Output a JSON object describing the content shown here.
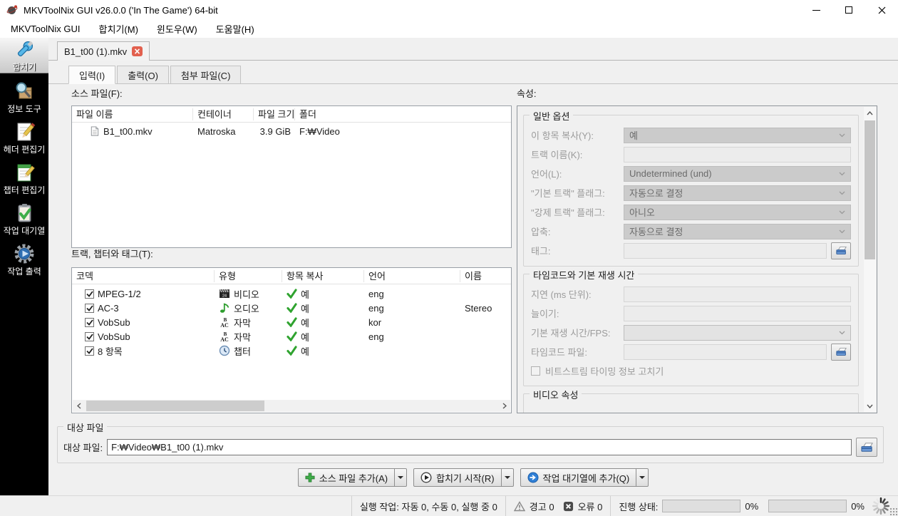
{
  "titlebar": {
    "title": "MKVToolNix GUI v26.0.0 ('In The Game') 64-bit"
  },
  "menubar": {
    "items": [
      {
        "label": "MKVToolNix GUI"
      },
      {
        "label": "합치기(M)"
      },
      {
        "label": "윈도우(W)"
      },
      {
        "label": "도움말(H)"
      }
    ]
  },
  "sidebar": {
    "items": [
      {
        "label": "합치기",
        "icon": "merge-icon",
        "selected": true
      },
      {
        "label": "정보 도구",
        "icon": "info-tool-icon",
        "selected": false
      },
      {
        "label": "헤더 편집기",
        "icon": "header-editor-icon",
        "selected": false
      },
      {
        "label": "챕터 편집기",
        "icon": "chapter-editor-icon",
        "selected": false
      },
      {
        "label": "작업 대기열",
        "icon": "job-queue-icon",
        "selected": false
      },
      {
        "label": "작업 출력",
        "icon": "job-output-icon",
        "selected": false
      }
    ]
  },
  "filetab": {
    "label": "B1_t00 (1).mkv"
  },
  "subtabs": {
    "items": [
      {
        "label": "입력(I)",
        "selected": true
      },
      {
        "label": "출력(O)",
        "selected": false
      },
      {
        "label": "첨부 파일(C)",
        "selected": false
      }
    ]
  },
  "source_files": {
    "label": "소스 파일(F):",
    "columns": [
      "파일 이름",
      "컨테이너",
      "파일 크기",
      "폴더"
    ],
    "rows": [
      {
        "name": "B1_t00.mkv",
        "container": "Matroska",
        "size": "3.9 GiB",
        "folder": "F:₩Video"
      }
    ]
  },
  "tracks": {
    "label": "트랙, 챕터와 태그(T):",
    "columns": [
      "코덱",
      "유형",
      "항목 복사",
      "언어",
      "이름"
    ],
    "rows": [
      {
        "codec": "MPEG-1/2",
        "type": "비디오",
        "copy": "예",
        "language": "eng",
        "name": "",
        "checked": true,
        "icon": "video-track-icon"
      },
      {
        "codec": "AC-3",
        "type": "오디오",
        "copy": "예",
        "language": "eng",
        "name": "Stereo",
        "checked": true,
        "icon": "audio-track-icon"
      },
      {
        "codec": "VobSub",
        "type": "자막",
        "copy": "예",
        "language": "kor",
        "name": "",
        "checked": true,
        "icon": "subtitle-track-icon"
      },
      {
        "codec": "VobSub",
        "type": "자막",
        "copy": "예",
        "language": "eng",
        "name": "",
        "checked": true,
        "icon": "subtitle-track-icon"
      },
      {
        "codec": "8 항목",
        "type": "챕터",
        "copy": "예",
        "language": "",
        "name": "",
        "checked": true,
        "icon": "chapter-track-icon"
      }
    ]
  },
  "properties": {
    "label": "속성:",
    "general": {
      "legend": "일반 옵션",
      "fields": [
        {
          "label": "이 항목 복사(Y):",
          "value": "예",
          "kind": "select"
        },
        {
          "label": "트랙 이름(K):",
          "value": "",
          "kind": "input"
        },
        {
          "label": "언어(L):",
          "value": "Undetermined (und)",
          "kind": "select"
        },
        {
          "label": "\"기본 트랙\" 플래그:",
          "value": "자동으로 결정",
          "kind": "select"
        },
        {
          "label": "\"강제 트랙\" 플래그:",
          "value": "아니오",
          "kind": "select"
        },
        {
          "label": "압축:",
          "value": "자동으로 결정",
          "kind": "select"
        },
        {
          "label": "태그:",
          "value": "",
          "kind": "file"
        }
      ]
    },
    "timing": {
      "legend": "타임코드와 기본 재생 시간",
      "fields": [
        {
          "label": "지연 (ms 단위):",
          "value": "",
          "kind": "input"
        },
        {
          "label": "늘이기:",
          "value": "",
          "kind": "input"
        },
        {
          "label": "기본 재생 시간/FPS:",
          "value": "",
          "kind": "select"
        },
        {
          "label": "타임코드 파일:",
          "value": "",
          "kind": "file"
        }
      ],
      "checkbox_label": "비트스트림 타이밍 정보 고치기"
    },
    "video": {
      "legend": "비디오 속성"
    }
  },
  "destination": {
    "legend": "대상 파일",
    "label": "대상 파일:",
    "value": "F:₩Video₩B1_t00 (1).mkv"
  },
  "actions": {
    "add_source": "소스 파일 추가(A)",
    "start_muxing": "합치기 시작(R)",
    "add_to_queue": "작업 대기열에 추가(Q)"
  },
  "statusbar": {
    "jobs": "실행 작업: 자동 0, 수동 0, 실행 중 0",
    "warnings": "경고 0",
    "errors": "오류 0",
    "progress_label": "진행 상태:",
    "progress1": "0%",
    "progress2": "0%"
  },
  "colors": {
    "accent_green": "#3fae49",
    "accent_blue": "#2f7fd6",
    "close_red": "#e2604e",
    "merge_blue": "#57b7e8"
  }
}
